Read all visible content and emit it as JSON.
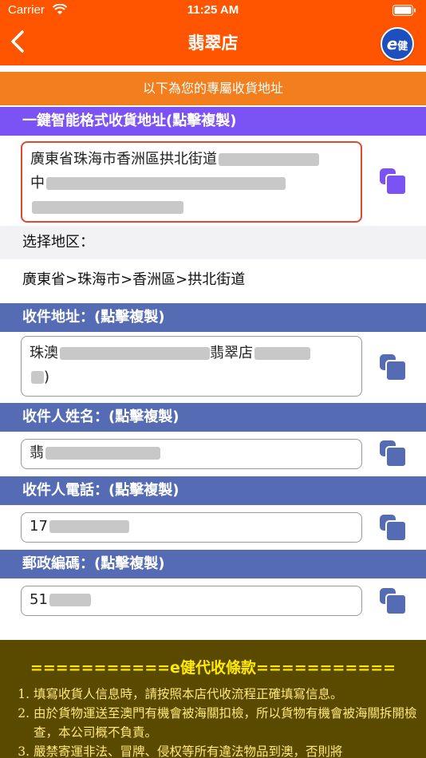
{
  "status": {
    "carrier": "Carrier",
    "time": "11:25 AM"
  },
  "nav": {
    "title": "翡翠店",
    "logo_letter": "e",
    "logo_text": "健"
  },
  "banner": "以下為您的專屬收貨地址",
  "smart_address": {
    "header": "一鍵智能格式收貨地址(點擊複製)",
    "line1": "廣東省珠海市香洲區拱北街道",
    "line2_prefix": "中"
  },
  "region": {
    "label": "选择地区：",
    "value": "廣東省>珠海市>香洲區>拱北街道"
  },
  "address": {
    "header": "收件地址：(點擊複製)",
    "prefix": "珠澳",
    "middle": "翡翠店",
    "suffix": ")"
  },
  "name": {
    "header": "收件人姓名：(點擊複製)",
    "prefix": "翡"
  },
  "phone": {
    "header": "收件人電話：(點擊複製)",
    "prefix": "17"
  },
  "postal": {
    "header": "郵政編碼：(點擊複製)",
    "prefix": "51"
  },
  "terms": {
    "title_rule_left": "===========",
    "title_e": "e",
    "title": "健代收條款",
    "title_rule_right": "===========",
    "items": [
      "填寫收貨人信息時，請按照本店代收流程正確填寫信息。",
      "由於貨物運送至澳門有機會被海關扣檢，所以貨物有機會被海關拆開檢查，本公司概不負責。",
      "嚴禁寄運非法、冒牌、侵权等所有違法物品到澳，否則將"
    ]
  },
  "colors": {
    "header": "#ff5500",
    "banner": "#f27e1d",
    "purple_section": "#7b53f5",
    "blue_section": "#556cb4",
    "copy_purple": "#7b53f5",
    "copy_blue": "#556cb4",
    "terms_bg": "#5a4a00"
  },
  "icons": {
    "back": "chevron-left-icon",
    "copy": "copy-icon",
    "wifi": "wifi-icon",
    "battery": "battery-icon"
  }
}
